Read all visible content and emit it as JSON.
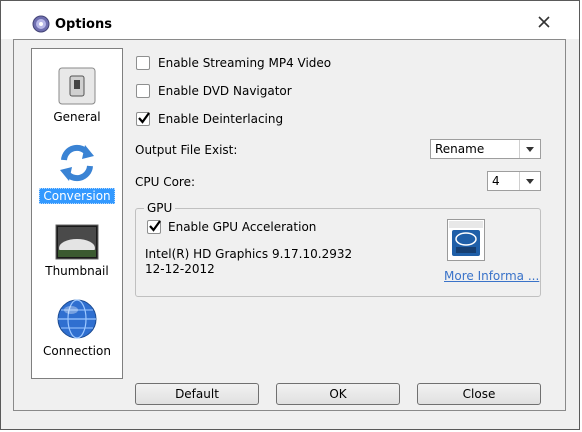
{
  "window": {
    "title": "Options",
    "title_icon": "disc-icon",
    "close_icon": "close-icon"
  },
  "sidebar": {
    "items": [
      {
        "label": "General",
        "icon": "switch-icon",
        "active": false
      },
      {
        "label": "Conversion",
        "icon": "refresh-arrows-icon",
        "active": true
      },
      {
        "label": "Thumbnail",
        "icon": "image-icon",
        "active": false
      },
      {
        "label": "Connection",
        "icon": "globe-icon",
        "active": false
      }
    ]
  },
  "options": {
    "streaming_mp4": {
      "label": "Enable Streaming MP4 Video",
      "checked": false
    },
    "dvd_navigator": {
      "label": "Enable DVD Navigator",
      "checked": false
    },
    "deinterlacing": {
      "label": "Enable Deinterlacing",
      "checked": true
    },
    "output_file_exist": {
      "label": "Output File Exist:",
      "value": "Rename"
    },
    "cpu_core": {
      "label": "CPU Core:",
      "value": "4"
    }
  },
  "gpu": {
    "group_label": "GPU",
    "acceleration": {
      "label": "Enable GPU Acceleration",
      "checked": true
    },
    "adapter": "Intel(R) HD Graphics 9.17.10.2932",
    "date": "12-12-2012",
    "badge_icon": "intel-core-badge-icon",
    "more_info_link": "More Informa ..."
  },
  "buttons": {
    "default": "Default",
    "ok": "OK",
    "close": "Close"
  }
}
